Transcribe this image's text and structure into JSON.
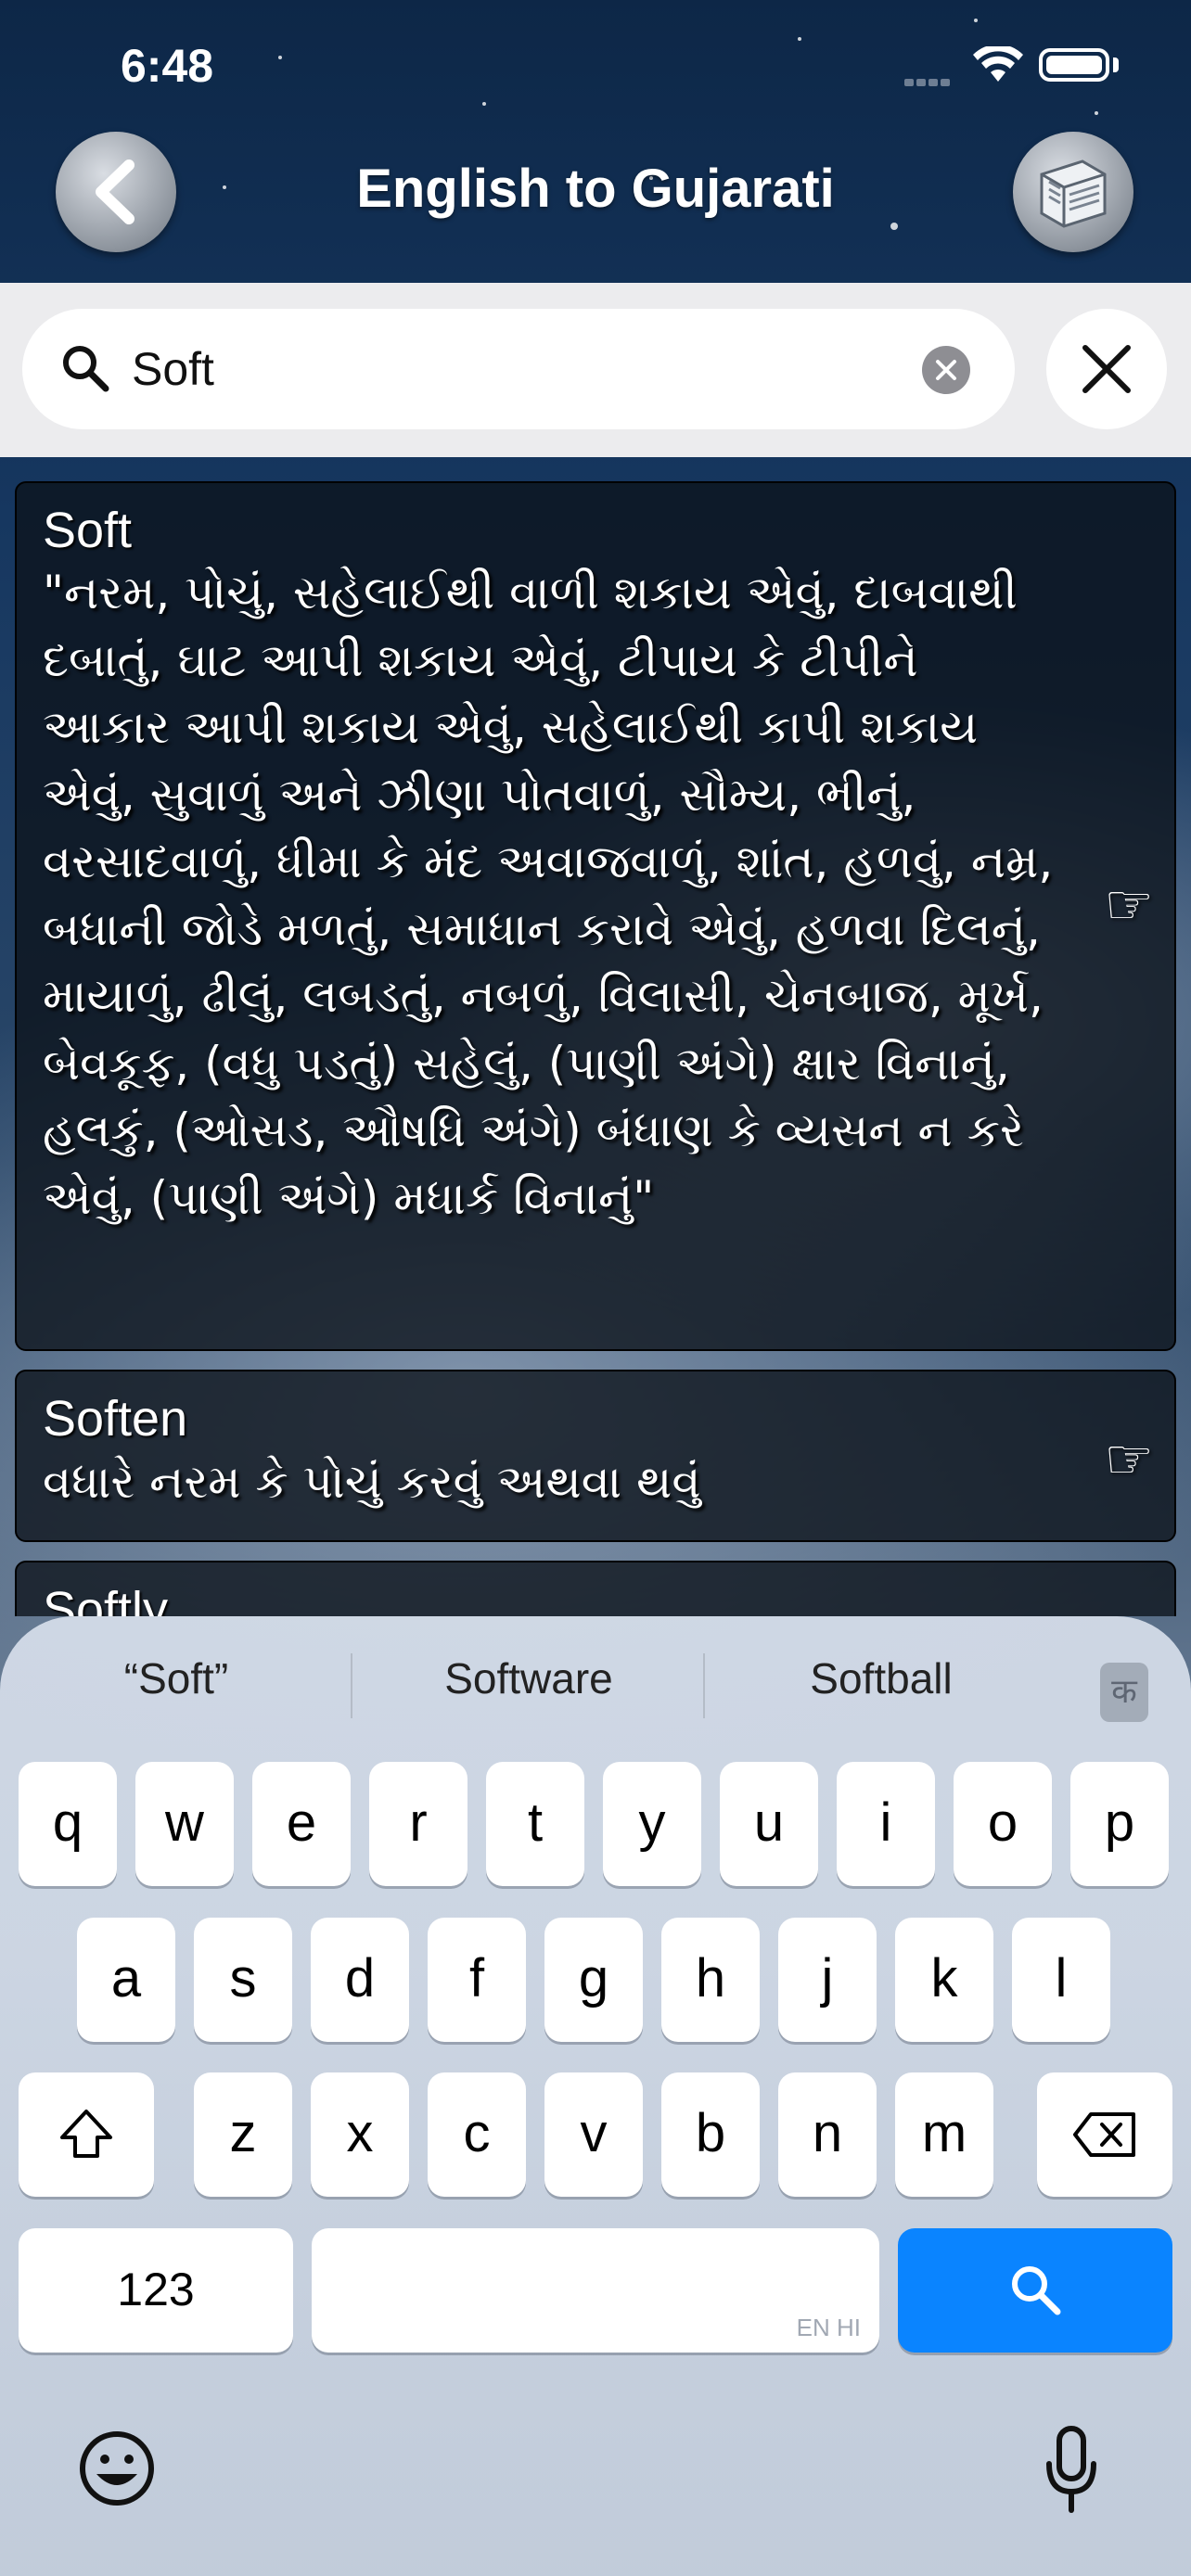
{
  "status_bar": {
    "time": "6:48"
  },
  "header": {
    "title": "English to Gujarati"
  },
  "search": {
    "query": "Soft"
  },
  "results": [
    {
      "word": "Soft",
      "meaning": "\"નરમ, પોચું, સહેલાઈથી વાળી શકાય એવું, દાબવાથી દબાતું, ઘાટ આપી શકાય એવું, ટીપાય કે ટીપીને આકાર આપી શકાય એવું, સહેલાઈથી કાપી શકાય એવું, સુવાળું અને ઝીણા પોતવાળું, સૌમ્ય, ભીનું, વરસાદવાળું, ધીમા કે મંદ અવાજવાળું, શાંત, હળવું, નમ્ર, બધાની જોડે મળતું, સમાધાન કરાવે એવું, હળવા દિલનું, માયાળું, ઢીલું, લબડતું, નબળું, વિલાસી, ચેનબાજ, મૂર્ખ, બેવકૂફ, (વધુ પડતું) સહેલું, (પાણી અંગે) ક્ષાર વિનાનું, હલકું, (ઓસડ, ઔષધિ અંગે) બંધાણ કે વ્યસન ન કરે એવું, (પાણી અંગે) મધાર્ક વિનાનું\""
    },
    {
      "word": "Soften",
      "meaning": "વધારે નરમ કે પોચું કરવું અથવા થવું"
    },
    {
      "word": "Softly",
      "meaning": ""
    }
  ],
  "keyboard": {
    "suggestions": [
      "“Soft”",
      "Software",
      "Softball"
    ],
    "lang_key": "क",
    "row1": [
      "q",
      "w",
      "e",
      "r",
      "t",
      "y",
      "u",
      "i",
      "o",
      "p"
    ],
    "row2": [
      "a",
      "s",
      "d",
      "f",
      "g",
      "h",
      "j",
      "k",
      "l"
    ],
    "row3": [
      "z",
      "x",
      "c",
      "v",
      "b",
      "n",
      "m"
    ],
    "numbers_key": "123",
    "space_hint": "EN HI"
  },
  "colors": {
    "accent": "#0a84ff",
    "card_bg": "#0c121a",
    "search_bg": "#ececee"
  }
}
